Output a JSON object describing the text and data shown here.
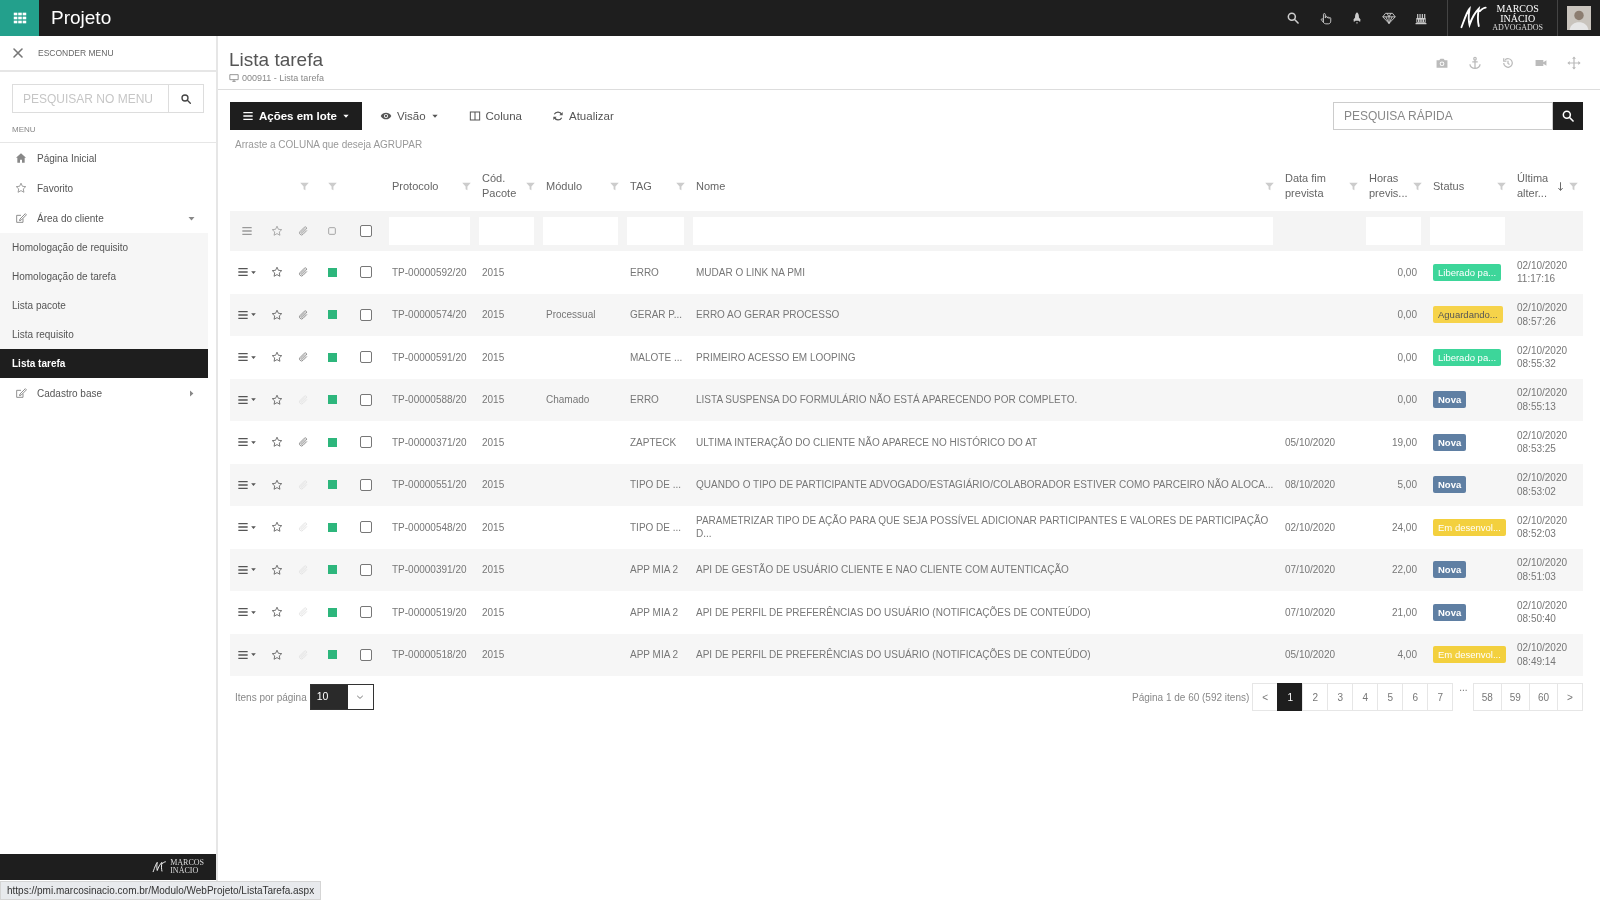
{
  "topbar": {
    "app_title": "Projeto",
    "logo_lines": [
      "MARCOS",
      "INÁCIO",
      "ADVOGADOS"
    ]
  },
  "sidebar": {
    "hide_label": "ESCONDER MENU",
    "search": {
      "placeholder": "PESQUISAR NO MENU"
    },
    "section_label": "MENU",
    "items": [
      {
        "label": "Página Inicial",
        "kind": "home",
        "selected": false
      },
      {
        "label": "Favorito",
        "kind": "favorite",
        "selected": false
      },
      {
        "label": "Área do cliente",
        "kind": "group",
        "selected": false,
        "expanded": true,
        "children": [
          {
            "label": "Homologação de requisito",
            "selected": false
          },
          {
            "label": "Homologação de tarefa",
            "selected": false
          },
          {
            "label": "Lista pacote",
            "selected": false
          },
          {
            "label": "Lista requisito",
            "selected": false
          },
          {
            "label": "Lista tarefa",
            "selected": true
          }
        ]
      },
      {
        "label": "Cadastro base",
        "kind": "group",
        "selected": false,
        "expanded": false
      }
    ],
    "footer_logo_lines": [
      "MARCOS",
      "INÁCIO"
    ]
  },
  "page": {
    "title": "Lista tarefa",
    "breadcrumb": "000911 - Lista tarefa"
  },
  "toolbar": {
    "buttons": [
      {
        "label": "Ações em lote",
        "kind": "batch"
      },
      {
        "label": "Visão",
        "kind": "view"
      },
      {
        "label": "Coluna",
        "kind": "columns"
      },
      {
        "label": "Atualizar",
        "kind": "refresh"
      }
    ],
    "quick_search": {
      "placeholder": "PESQUISA RÁPIDA"
    },
    "group_hint": "Arraste a COLUNA que deseja AGRUPAR"
  },
  "table": {
    "select_all_checked": false,
    "columns": [
      {
        "label": "Protocolo",
        "filter_field": true,
        "sorted": false
      },
      {
        "label": "Cód. Pacote",
        "filter_field": true,
        "sorted": false
      },
      {
        "label": "Módulo",
        "filter_field": true,
        "sorted": false
      },
      {
        "label": "TAG",
        "filter_field": true,
        "sorted": false
      },
      {
        "label": "Nome",
        "filter_field": true,
        "sorted": false
      },
      {
        "label": "Data fim prevista",
        "filter_field": false,
        "sorted": false
      },
      {
        "label": "Horas previs...",
        "filter_field": true,
        "sorted": false
      },
      {
        "label": "Status",
        "filter_field": true,
        "sorted": false
      },
      {
        "label": "Última alter...",
        "filter_field": false,
        "sorted": true
      }
    ],
    "rows": [
      {
        "attachment": true,
        "checked": false,
        "protocolo": "TP-00000592/20",
        "pacote": "2015",
        "tag": "ERRO",
        "nome": "MUDAR O LINK NA PMI",
        "horas": "0,00",
        "status": {
          "label": "Liberado pa...",
          "kind": "released"
        },
        "date": "02/10/2020",
        "time": "11:17:16"
      },
      {
        "attachment": true,
        "checked": false,
        "protocolo": "TP-00000574/20",
        "pacote": "2015",
        "modulo": "Processual",
        "tag": "GERAR P...",
        "nome": "ERRO AO GERAR PROCESSO",
        "horas": "0,00",
        "status": {
          "label": "Aguardando...",
          "kind": "waiting"
        },
        "date": "02/10/2020",
        "time": "08:57:26"
      },
      {
        "attachment": true,
        "checked": false,
        "protocolo": "TP-00000591/20",
        "pacote": "2015",
        "tag": "MALOTE ...",
        "nome": "PRIMEIRO ACESSO EM LOOPING",
        "horas": "0,00",
        "status": {
          "label": "Liberado pa...",
          "kind": "released"
        },
        "date": "02/10/2020",
        "time": "08:55:32"
      },
      {
        "attachment": false,
        "checked": false,
        "protocolo": "TP-00000588/20",
        "pacote": "2015",
        "modulo": "Chamado",
        "tag": "ERRO",
        "nome": "LISTA SUSPENSA DO FORMULÁRIO NÃO ESTÁ APARECENDO POR COMPLETO.",
        "horas": "0,00",
        "status": {
          "label": "Nova",
          "kind": "new"
        },
        "date": "02/10/2020",
        "time": "08:55:13"
      },
      {
        "attachment": true,
        "checked": false,
        "protocolo": "TP-00000371/20",
        "pacote": "2015",
        "tag": "ZAPTECK",
        "nome": "ULTIMA INTERAÇÃO DO CLIENTE NÃO APARECE NO HISTÓRICO DO AT",
        "data_fim": "05/10/2020",
        "horas": "19,00",
        "status": {
          "label": "Nova",
          "kind": "new"
        },
        "date": "02/10/2020",
        "time": "08:53:25"
      },
      {
        "attachment": false,
        "checked": false,
        "protocolo": "TP-00000551/20",
        "pacote": "2015",
        "tag": "TIPO DE ...",
        "nome": "QUANDO O TIPO DE PARTICIPANTE ADVOGADO/ESTAGIÁRIO/COLABORADOR ESTIVER COMO PARCEIRO NÃO ALOCA...",
        "data_fim": "08/10/2020",
        "horas": "5,00",
        "status": {
          "label": "Nova",
          "kind": "new"
        },
        "date": "02/10/2020",
        "time": "08:53:02"
      },
      {
        "attachment": false,
        "checked": false,
        "protocolo": "TP-00000548/20",
        "pacote": "2015",
        "tag": "TIPO DE ...",
        "nome": "PARAMETRIZAR TIPO DE AÇÃO PARA QUE SEJA POSSÍVEL ADICIONAR PARTICIPANTES E VALORES DE PARTICIPAÇÃO D...",
        "data_fim": "02/10/2020",
        "horas": "24,00",
        "status": {
          "label": "Em desenvol...",
          "kind": "in_progress"
        },
        "date": "02/10/2020",
        "time": "08:52:03"
      },
      {
        "attachment": false,
        "checked": false,
        "protocolo": "TP-00000391/20",
        "pacote": "2015",
        "tag": "APP MIA 2",
        "nome": "API DE GESTÃO DE USUÁRIO CLIENTE E NAO CLIENTE COM AUTENTICAÇÃO",
        "data_fim": "07/10/2020",
        "horas": "22,00",
        "status": {
          "label": "Nova",
          "kind": "new"
        },
        "date": "02/10/2020",
        "time": "08:51:03"
      },
      {
        "attachment": false,
        "checked": false,
        "protocolo": "TP-00000519/20",
        "pacote": "2015",
        "tag": "APP MIA 2",
        "nome": "API DE PERFIL DE PREFERÊNCIAS DO USUÁRIO (NOTIFICAÇÕES DE CONTEÚDO)",
        "data_fim": "07/10/2020",
        "horas": "21,00",
        "status": {
          "label": "Nova",
          "kind": "new"
        },
        "date": "02/10/2020",
        "time": "08:50:40"
      },
      {
        "attachment": false,
        "checked": false,
        "protocolo": "TP-00000518/20",
        "pacote": "2015",
        "tag": "APP MIA 2",
        "nome": "API DE PERFIL DE PREFERÊNCIAS DO USUÁRIO (NOTIFICAÇÕES DE CONTEÚDO)",
        "data_fim": "05/10/2020",
        "horas": "4,00",
        "status": {
          "label": "Em desenvol...",
          "kind": "in_progress"
        },
        "date": "02/10/2020",
        "time": "08:49:14"
      }
    ]
  },
  "pager": {
    "per_page_label": "Itens por página",
    "per_page": "10",
    "info": "Página 1 de 60 (592 itens)",
    "pages": [
      {
        "label": "<",
        "selected": false
      },
      {
        "label": "1",
        "selected": true
      },
      {
        "label": "2",
        "selected": false
      },
      {
        "label": "3",
        "selected": false
      },
      {
        "label": "4",
        "selected": false
      },
      {
        "label": "5",
        "selected": false
      },
      {
        "label": "6",
        "selected": false
      },
      {
        "label": "7",
        "selected": false
      },
      {
        "label": "...",
        "kind": "gap"
      },
      {
        "label": "58",
        "selected": false
      },
      {
        "label": "59",
        "selected": false
      },
      {
        "label": "60",
        "selected": false
      },
      {
        "label": ">",
        "selected": false
      }
    ]
  },
  "status_url": "https://pmi.marcosinacio.com.br/Modulo/WebProjeto/ListaTarefa.aspx"
}
